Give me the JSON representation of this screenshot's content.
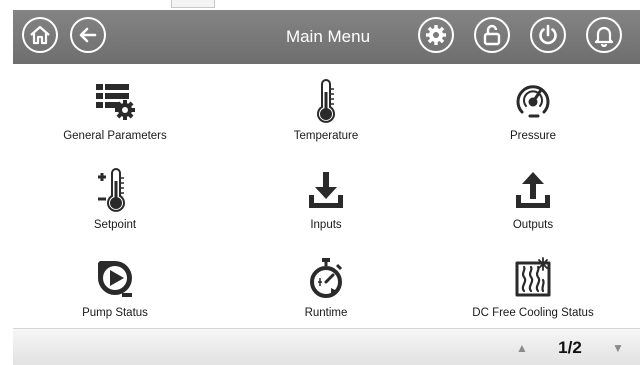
{
  "header": {
    "title": "Main Menu",
    "left_buttons": [
      {
        "icon": "home-icon"
      },
      {
        "icon": "back-arrow-icon"
      }
    ],
    "right_buttons": [
      {
        "icon": "gear-icon"
      },
      {
        "icon": "unlock-icon"
      },
      {
        "icon": "power-icon"
      },
      {
        "icon": "bell-icon"
      }
    ]
  },
  "menu": {
    "items": [
      {
        "label": "General Parameters",
        "icon": "parameters-icon"
      },
      {
        "label": "Temperature",
        "icon": "thermometer-icon"
      },
      {
        "label": "Pressure",
        "icon": "pressure-gauge-icon"
      },
      {
        "label": "Setpoint",
        "icon": "setpoint-icon"
      },
      {
        "label": "Inputs",
        "icon": "download-icon"
      },
      {
        "label": "Outputs",
        "icon": "upload-icon"
      },
      {
        "label": "Pump Status",
        "icon": "pump-icon"
      },
      {
        "label": "Runtime",
        "icon": "stopwatch-icon"
      },
      {
        "label": "DC Free Cooling Status",
        "icon": "free-cooling-icon"
      }
    ]
  },
  "pager": {
    "up_symbol": "▲",
    "page": "1/2",
    "down_symbol": "▼"
  },
  "colors": {
    "header_bg": "#7a7a7a",
    "icon_dark": "#2a2a2a"
  }
}
